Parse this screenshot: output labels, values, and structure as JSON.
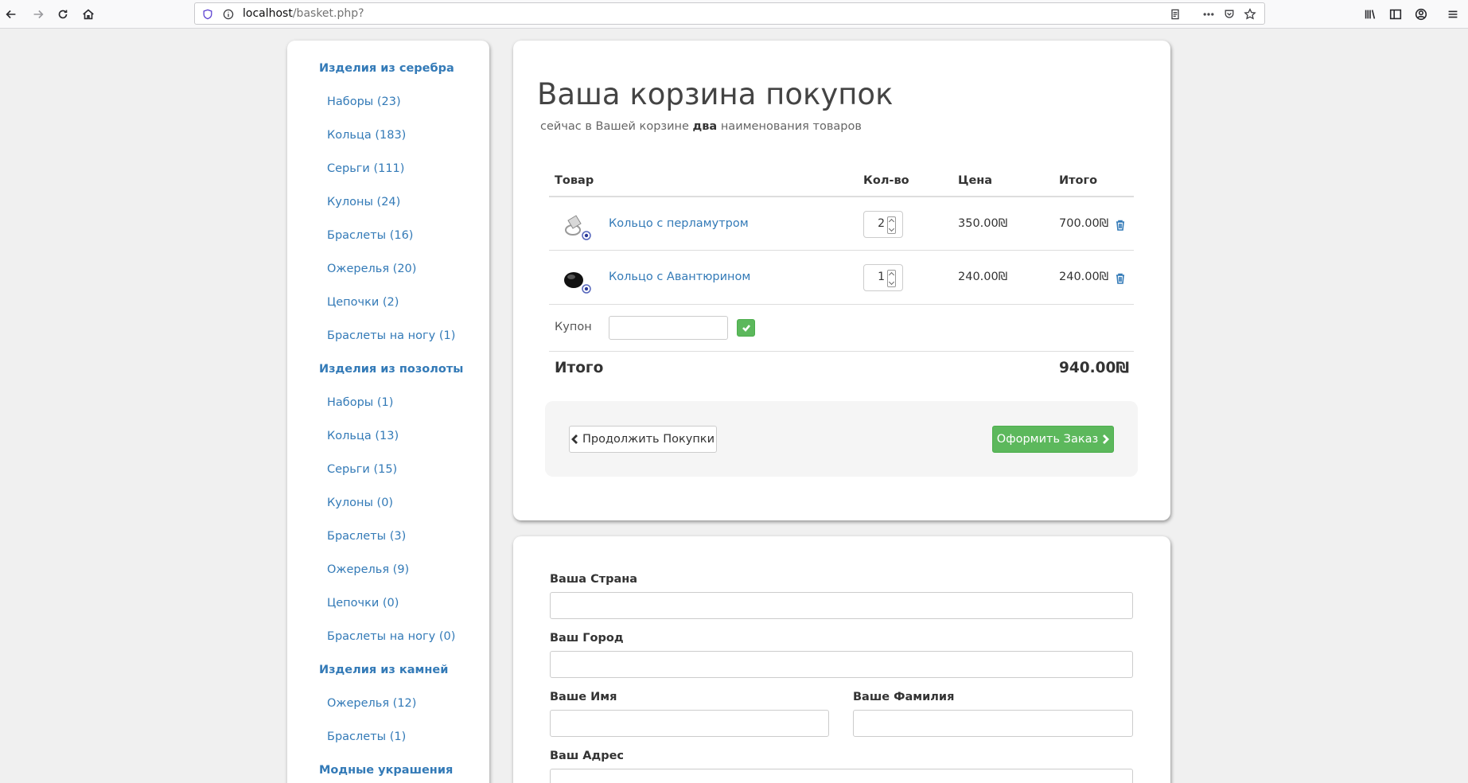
{
  "browser": {
    "url_host": "localhost",
    "url_path": "/basket.php?"
  },
  "sidebar": {
    "groups": [
      {
        "title": "Изделия из серебра",
        "items": [
          "Наборы (23)",
          "Кольца (183)",
          "Серьги (111)",
          "Кулоны (24)",
          "Браслеты (16)",
          "Ожерелья (20)",
          "Цепочки (2)",
          "Браслеты на ногу (1)"
        ]
      },
      {
        "title": "Изделия из позолоты",
        "items": [
          "Наборы (1)",
          "Кольца (13)",
          "Серьги (15)",
          "Кулоны (0)",
          "Браслеты (3)",
          "Ожерелья (9)",
          "Цепочки (0)",
          "Браслеты на ногу (0)"
        ]
      },
      {
        "title": "Изделия из камней",
        "items": [
          "Ожерелья (12)",
          "Браслеты (1)"
        ]
      },
      {
        "title": "Модные украшения",
        "items": []
      }
    ]
  },
  "basket": {
    "title": "Ваша корзина покупок",
    "subtitle_before": "сейчас в Вашей корзине ",
    "subtitle_bold": "два",
    "subtitle_after": " наименования товаров",
    "headers": {
      "product": "Товар",
      "qty": "Кол-во",
      "price": "Цена",
      "total": "Итого"
    },
    "rows": [
      {
        "name": "Кольцо с перламутром",
        "qty": "2",
        "price": "350.00₪",
        "total": "700.00₪"
      },
      {
        "name": "Кольцо с Авантюрином",
        "qty": "1",
        "price": "240.00₪",
        "total": "240.00₪"
      }
    ],
    "coupon_label": "Купон",
    "sum_label": "Итого",
    "sum_value": "940.00₪",
    "continue_label": "Продолжить Покупки",
    "order_label": "Оформить Заказ"
  },
  "form": {
    "country_label": "Ваша Страна",
    "city_label": "Ваш Город",
    "first_name_label": "Ваше Имя",
    "last_name_label": "Ваше Фамилия",
    "address_label": "Ваш Адрес"
  }
}
